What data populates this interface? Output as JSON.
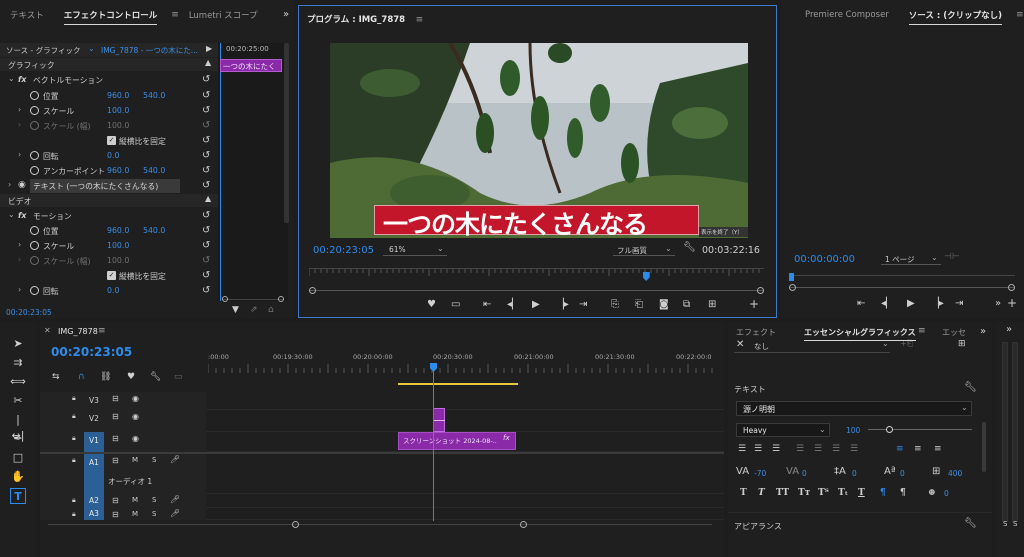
{
  "left_panel": {
    "tabs": [
      "テキスト",
      "エフェクトコントロール",
      "Lumetri スコープ"
    ],
    "source_label": "ソース - グラフィック",
    "sequence_label": "IMG_7878 - 一つの木にた...",
    "mini_timecode": "00:20:25:00",
    "clip_mini_label": "一つの木にたく",
    "sections": {
      "graphic": "グラフィック",
      "video": "ビデオ"
    },
    "vector_motion": {
      "fx_label": "fx",
      "title": "ベクトルモーション",
      "position_label": "位置",
      "position_x": "960.0",
      "position_y": "540.0",
      "scale_label": "スケール",
      "scale_value": "100.0",
      "scale_width_label": "スケール (幅)",
      "scale_width_value": "100.0",
      "uniform_label": "縦横比を固定",
      "rotation_label": "回転",
      "rotation_value": "0.0",
      "anchor_label": "アンカーポイント",
      "anchor_x": "960.0",
      "anchor_y": "540.0"
    },
    "text_layer": "テキスト (一つの木にたくさんなる)",
    "motion": {
      "fx_label": "fx",
      "title": "モーション",
      "position_label": "位置",
      "position_x": "960.0",
      "position_y": "540.0",
      "scale_label": "スケール",
      "scale_value": "100.0",
      "scale_width_label": "スケール (幅)",
      "scale_width_value": "100.0",
      "uniform_label": "縦横比を固定",
      "rotation_label": "回転",
      "rotation_value": "0.0"
    },
    "bottom_timecode": "00:20:23:05"
  },
  "program_monitor": {
    "title": "プログラム : IMG_7878",
    "caption": "一つの木にたくさんなる",
    "exit_label": "表示を終了（Y）",
    "current_timecode": "00:20:23:05",
    "zoom": "61%",
    "quality": "フル画質",
    "duration": "00:03:22:16",
    "playhead_fraction": 0.74
  },
  "source_monitor": {
    "tabs": [
      "Premiere Composer",
      "ソース : (クリップなし)"
    ],
    "timecode": "00:00:00:00",
    "page_select": "1 ページ"
  },
  "timeline": {
    "sequence_name": "IMG_7878",
    "timecode": "00:20:23:05",
    "ruler_labels": [
      ":00:00",
      "00:19:30:00",
      "00:20:00:00",
      "00:20:30:00",
      "00:21:00:00",
      "00:21:30:00",
      "00:22:00:0"
    ],
    "tracks": [
      {
        "name": "V3",
        "kind": "video",
        "highlight": false
      },
      {
        "name": "V2",
        "kind": "video",
        "highlight": false
      },
      {
        "name": "V1",
        "kind": "video",
        "highlight": true
      },
      {
        "name": "A1",
        "kind": "audio",
        "highlight": true,
        "label": "オーディオ 1"
      },
      {
        "name": "A2",
        "kind": "audio",
        "highlight": true
      },
      {
        "name": "A3",
        "kind": "audio",
        "highlight": true
      }
    ],
    "clip_label": "スクリーンショット 2024-08-..",
    "clip_fx": "fx",
    "toggle_m": "M",
    "toggle_s": "S"
  },
  "essential_graphics": {
    "tabs": [
      "エフェクト",
      "エッセンシャルグラフィックス",
      "エッセ"
    ],
    "style_value": "なし",
    "text_heading": "テキスト",
    "font_name": "源ノ明朝",
    "font_weight": "Heavy",
    "font_size": "100",
    "tracking": "-70",
    "kerning": "0",
    "leading": "0",
    "baseline": "0",
    "tsume": "0",
    "tab_width": "400",
    "stroke_width": "0",
    "appearance_heading": "アピアランス"
  },
  "audio_meter": {
    "solo_left": "S",
    "solo_right": "S"
  },
  "colors": {
    "accent_blue": "#2d8ceb",
    "clip_purple": "#8a2aa8",
    "caption_red": "#c4162b",
    "panel_bg": "#1f1f1f",
    "active_border": "#3f79c9"
  }
}
